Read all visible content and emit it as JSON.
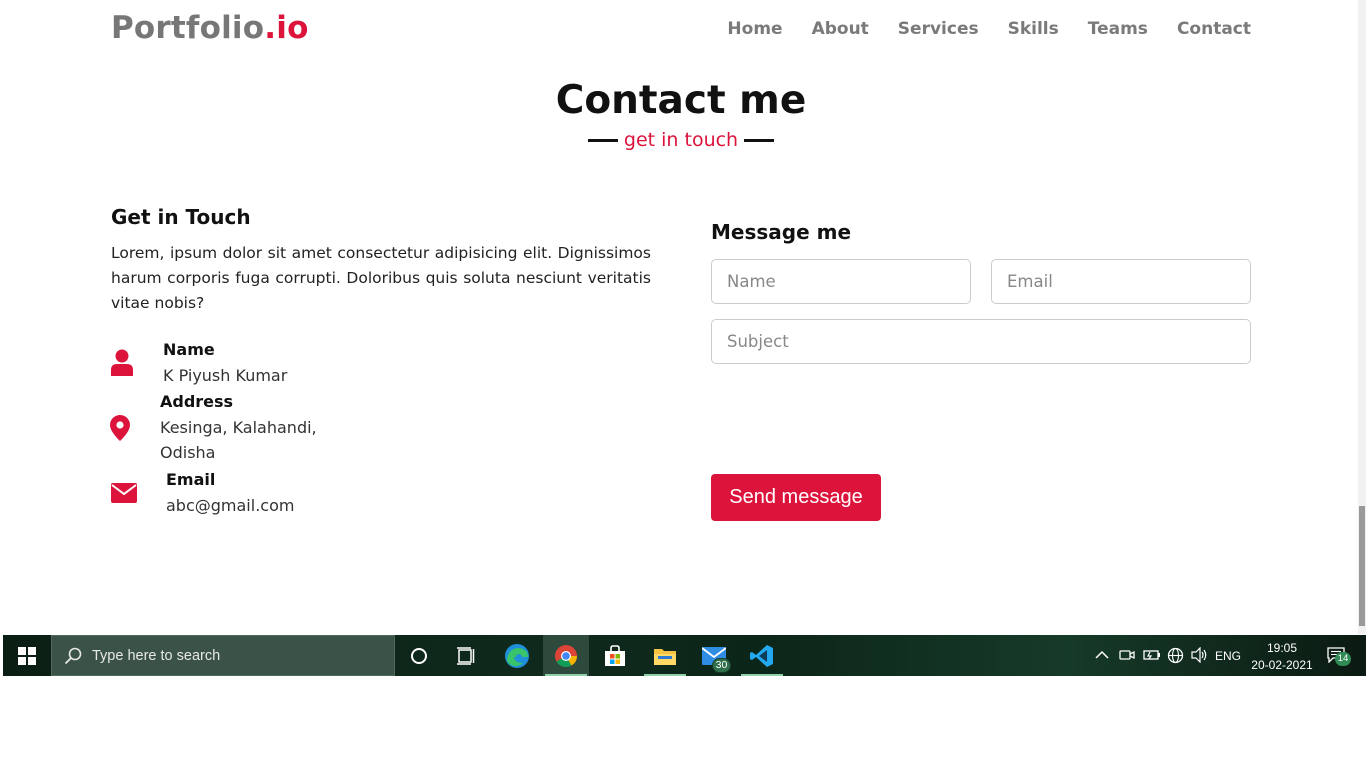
{
  "navbar": {
    "logo_main": "Portfolio",
    "logo_accent": ".io",
    "links": [
      "Home",
      "About",
      "Services",
      "Skills",
      "Teams",
      "Contact"
    ]
  },
  "section": {
    "title": "Contact me",
    "subtitle": "get in touch"
  },
  "left": {
    "heading": "Get in Touch",
    "paragraph": "Lorem, ipsum dolor sit amet consectetur adipisicing elit. Dignissimos harum corporis fuga corrupti. Doloribus quis soluta nesciunt veritatis vitae nobis?",
    "info": [
      {
        "icon": "user-icon",
        "title": "Name",
        "value": "K Piyush Kumar"
      },
      {
        "icon": "map-marker-icon",
        "title": "Address",
        "value_line1": "Kesinga, Kalahandi,",
        "value_line2": "Odisha"
      },
      {
        "icon": "envelope-icon",
        "title": "Email",
        "value": "abc@gmail.com"
      }
    ]
  },
  "form": {
    "heading": "Message me",
    "name_placeholder": "Name",
    "email_placeholder": "Email",
    "subject_placeholder": "Subject",
    "send_label": "Send message"
  },
  "taskbar": {
    "search_placeholder": "Type here to search",
    "mail_badge": "30",
    "language": "ENG",
    "time": "19:05",
    "date": "20-02-2021",
    "notifications_badge": "14"
  },
  "colors": {
    "accent": "#dc143c",
    "nav_text": "#7a7a7a"
  }
}
